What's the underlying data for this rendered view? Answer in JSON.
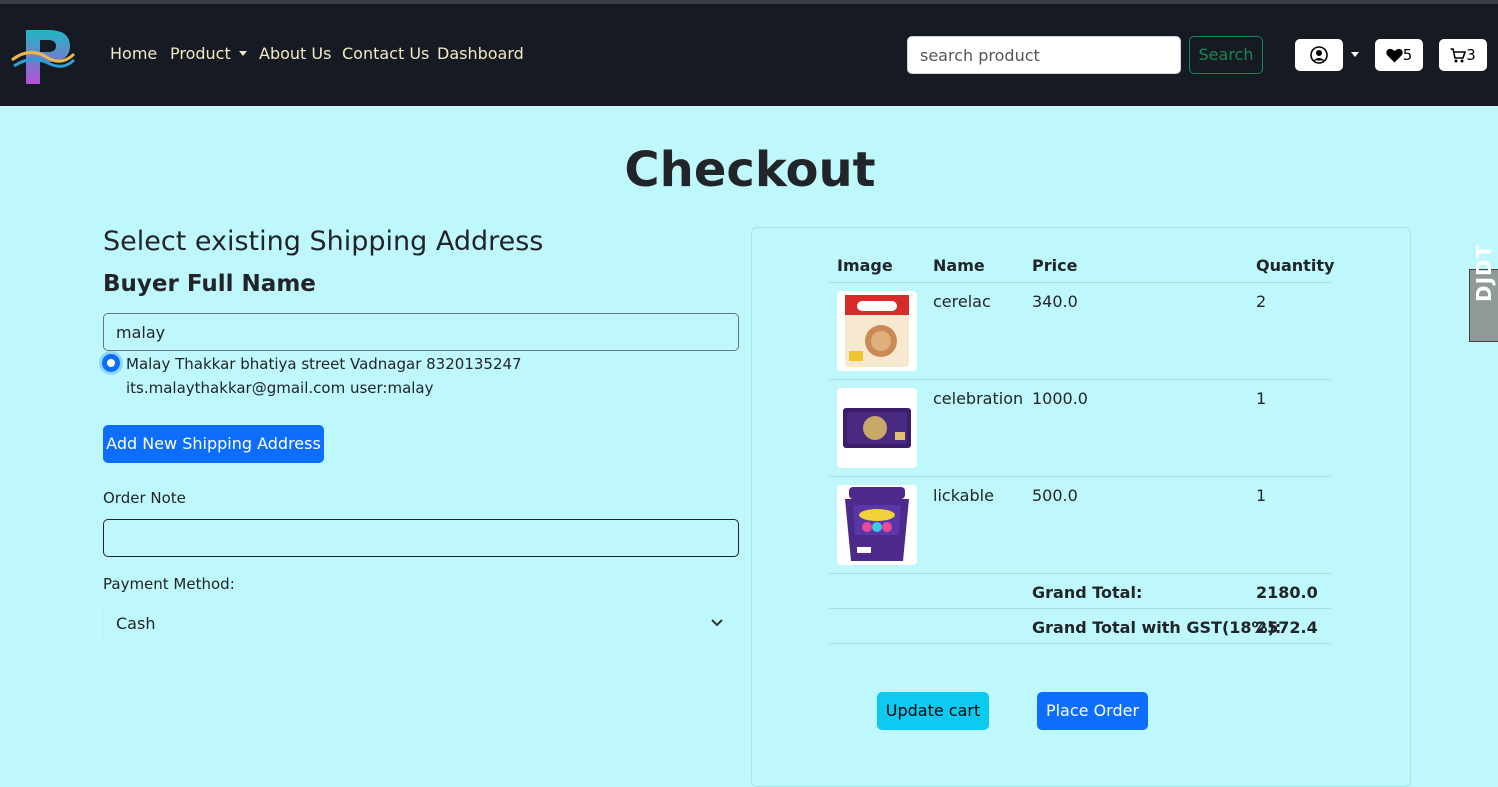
{
  "nav": {
    "links": [
      "Home",
      "Product",
      "About Us",
      "Contact Us",
      "Dashboard"
    ],
    "search_placeholder": "search product",
    "search_button": "Search",
    "wishlist_count": "5",
    "cart_count": "3",
    "text_color": "#f2e8c4",
    "bg_color": "#161a23"
  },
  "side_tab": "DJDT",
  "page": {
    "title": "Checkout",
    "bg_color": "#bff8fc"
  },
  "shipping": {
    "heading": "Select existing Shipping Address",
    "buyer_label": "Buyer Full Name",
    "buyer_value": "malay",
    "address_line": "Malay Thakkar bhatiya street Vadnagar 8320135247 its.malaythakkar@gmail.com user:malay",
    "add_button": "Add New Shipping Address",
    "order_note_label": "Order Note",
    "order_note_value": "",
    "payment_label": "Payment Method:",
    "payment_selected": "Cash"
  },
  "cart": {
    "headers": [
      "Image",
      "Name",
      "Price",
      "Quantity"
    ],
    "items": [
      {
        "name": "cerelac",
        "price": "340.0",
        "quantity": "2",
        "image_icon": "cerelac-product-image"
      },
      {
        "name": "celebration",
        "price": "1000.0",
        "quantity": "1",
        "image_icon": "celebration-product-image"
      },
      {
        "name": "lickable",
        "price": "500.0",
        "quantity": "1",
        "image_icon": "lickables-product-image"
      }
    ],
    "grand_total_label": "Grand Total:",
    "grand_total_value": "2180.0",
    "gst_total_label": "Grand Total with GST(18%):",
    "gst_total_value": "2572.4",
    "update_button": "Update cart",
    "place_button": "Place Order"
  }
}
